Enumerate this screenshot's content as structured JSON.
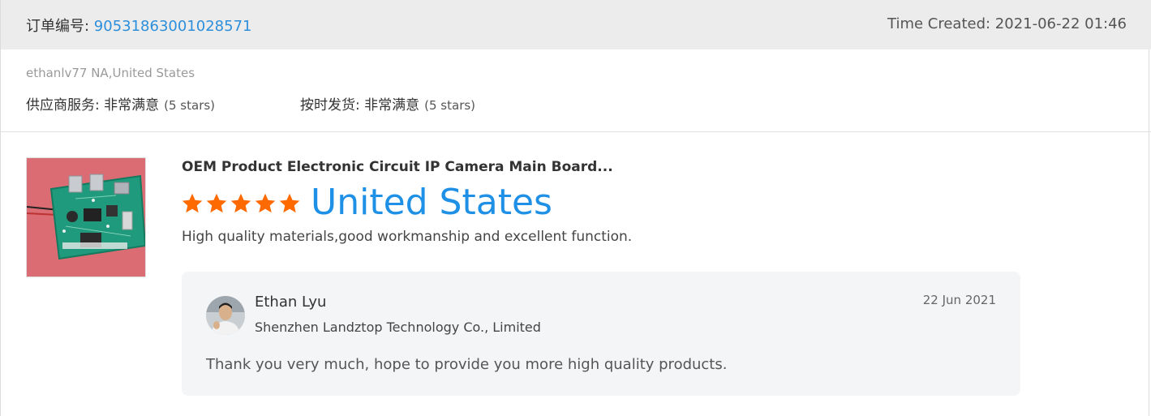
{
  "header": {
    "order_label": "订单编号: ",
    "order_number": "90531863001028571",
    "time_created": "Time Created: 2021-06-22 01:46"
  },
  "buyer": {
    "name": "ethanlv77 NA,United States",
    "supplier_service": {
      "label": "供应商服务: 非常满意",
      "stars_note": "(5 stars)"
    },
    "on_time_shipping": {
      "label": "按时发货: 非常满意",
      "stars_note": "(5 stars)"
    }
  },
  "review": {
    "product_title": "OEM Product Electronic Circuit IP Camera Main Board...",
    "rating": 5,
    "star_color": "#ff6a00",
    "country": "United States",
    "text": "High quality materials,good workmanship and excellent function."
  },
  "reply": {
    "seller_name": "Ethan Lyu",
    "company": "Shenzhen Landztop Technology Co., Limited",
    "date": "22 Jun 2021",
    "text": "Thank you very much, hope to provide you more high quality products."
  },
  "icons": {
    "star": "star-icon",
    "avatar": "avatar-photo",
    "product": "product-thumbnail"
  }
}
